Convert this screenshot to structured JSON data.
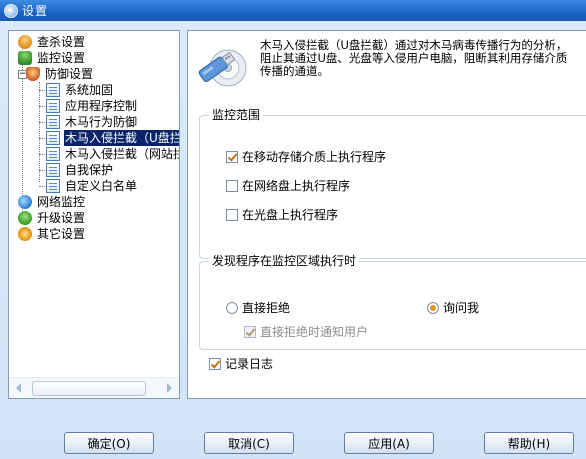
{
  "window": {
    "title": "设置",
    "icon": "settings-shield-icon"
  },
  "tree": {
    "items": [
      {
        "label": "查杀设置",
        "icon": "scan-icon",
        "level": 0
      },
      {
        "label": "监控设置",
        "icon": "monitor-icon",
        "level": 0
      },
      {
        "label": "防御设置",
        "icon": "defense-icon",
        "level": 0,
        "expanded": true
      },
      {
        "label": "系统加固",
        "icon": "doc-icon",
        "level": 1
      },
      {
        "label": "应用程序控制",
        "icon": "doc-icon",
        "level": 1
      },
      {
        "label": "木马行为防御",
        "icon": "doc-icon",
        "level": 1
      },
      {
        "label": "木马入侵拦截（U盘拦",
        "icon": "doc-icon",
        "level": 1,
        "selected": true
      },
      {
        "label": "木马入侵拦截（网站拦",
        "icon": "doc-icon",
        "level": 1
      },
      {
        "label": "自我保护",
        "icon": "doc-icon",
        "level": 1
      },
      {
        "label": "自定义白名单",
        "icon": "doc-icon",
        "level": 1
      },
      {
        "label": "网络监控",
        "icon": "network-icon",
        "level": 0
      },
      {
        "label": "升级设置",
        "icon": "upgrade-icon",
        "level": 0
      },
      {
        "label": "其它设置",
        "icon": "other-icon",
        "level": 0
      }
    ]
  },
  "content": {
    "description": "木马入侵拦截（U盘拦截）通过对木马病毒传播行为的分析，阻止其通过U盘、光盘等入侵用户电脑，阻断其利用存储介质传播的通道。",
    "desc_line1": "木马入侵拦截（U盘拦截）通过对木马病毒传播行为的分析，",
    "desc_line2": "阻止其通过U盘、光盘等入侵用户电脑，阻断其利用存储介质",
    "desc_line3": "传播的通道。",
    "scope_group": {
      "title": "监控范围",
      "options": [
        {
          "label": "在移动存储介质上执行程序",
          "checked": true
        },
        {
          "label": "在网络盘上执行程序",
          "checked": false
        },
        {
          "label": "在光盘上执行程序",
          "checked": false
        }
      ]
    },
    "found_group": {
      "title": "发现程序在监控区域执行时",
      "radio_reject": {
        "label": "直接拒绝",
        "checked": false
      },
      "radio_ask": {
        "label": "询问我",
        "checked": true
      },
      "notify": {
        "label": "直接拒绝时通知用户",
        "checked": true,
        "disabled": true
      }
    },
    "log": {
      "label": "记录日志",
      "checked": true
    }
  },
  "buttons": {
    "ok": "确定(O)",
    "cancel": "取消(C)",
    "apply": "应用(A)",
    "help": "帮助(H)"
  },
  "colors": {
    "titlebar": "#1c62c8",
    "selection": "#0a246a",
    "check_accent": "#c5720d",
    "radio_accent": "#e3921c"
  }
}
